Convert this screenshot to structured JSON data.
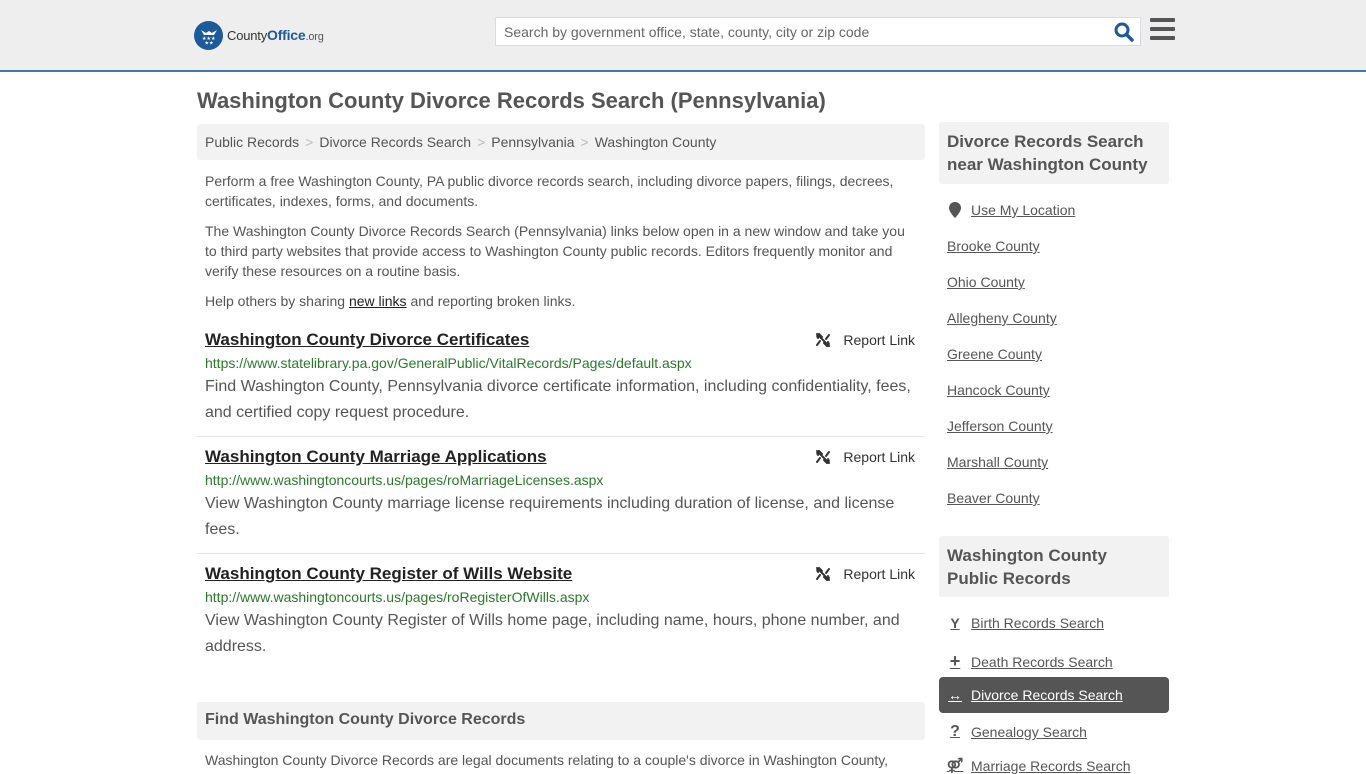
{
  "header": {
    "logo": {
      "name_part1": "County",
      "name_part2": "Office",
      "tld": ".org"
    },
    "search": {
      "placeholder": "Search by government office, state, county, city or zip code",
      "value": ""
    },
    "search_icon": "search-icon",
    "menu_icon": "hamburger-menu-icon"
  },
  "page": {
    "title": "Washington County Divorce Records Search (Pennsylvania)"
  },
  "breadcrumb": [
    "Public Records",
    "Divorce Records Search",
    "Pennsylvania",
    "Washington County"
  ],
  "intro": {
    "p1": "Perform a free Washington County, PA public divorce records search, including divorce papers, filings, decrees, certificates, indexes, forms, and documents.",
    "p2": "The Washington County Divorce Records Search (Pennsylvania) links below open in a new window and take you to third party websites that provide access to Washington County public records. Editors frequently monitor and verify these resources on a routine basis.",
    "p3_before": "Help others by sharing ",
    "p3_link": "new links",
    "p3_after": " and reporting broken links."
  },
  "results": [
    {
      "title": "Washington County Divorce Certificates",
      "url": "https://www.statelibrary.pa.gov/GeneralPublic/VitalRecords/Pages/default.aspx",
      "description": "Find Washington County, Pennsylvania divorce certificate information, including confidentiality, fees, and certified copy request procedure.",
      "report_label": "Report Link"
    },
    {
      "title": "Washington County Marriage Applications",
      "url": "http://www.washingtoncourts.us/pages/roMarriageLicenses.aspx",
      "description": "View Washington County marriage license requirements including duration of license, and license fees.",
      "report_label": "Report Link"
    },
    {
      "title": "Washington County Register of Wills Website",
      "url": "http://www.washingtoncourts.us/pages/roRegisterOfWills.aspx",
      "description": "View Washington County Register of Wills home page, including name, hours, phone number, and address.",
      "report_label": "Report Link"
    }
  ],
  "find_section": {
    "heading": "Find Washington County Divorce Records",
    "text": "Washington County Divorce Records are legal documents relating to a couple's divorce in Washington County,"
  },
  "sidebar": {
    "nearby_heading": "Divorce Records Search near Washington County",
    "use_location": "Use My Location",
    "nearby": [
      "Brooke County",
      "Ohio County",
      "Allegheny County",
      "Greene County",
      "Hancock County",
      "Jefferson County",
      "Marshall County",
      "Beaver County"
    ],
    "public_heading": "Washington County Public Records",
    "public_links": [
      {
        "label": "Birth Records Search",
        "icon": "child-icon",
        "glyph": "Y"
      },
      {
        "label": "Death Records Search",
        "icon": "plus-icon",
        "glyph": "+"
      },
      {
        "label": "Divorce Records Search",
        "icon": "arrows-horizontal-icon",
        "glyph": "↔",
        "active": true
      },
      {
        "label": "Genealogy Search",
        "icon": "question-icon",
        "glyph": "?"
      },
      {
        "label": "Marriage Records Search",
        "icon": "marriage-symbol-icon",
        "glyph": "⚤"
      }
    ]
  },
  "colors": {
    "brand_blue": "#1d5a9c",
    "header_border": "#3a7cad",
    "url_green": "#2a7a2a",
    "active_bg": "#555555"
  }
}
